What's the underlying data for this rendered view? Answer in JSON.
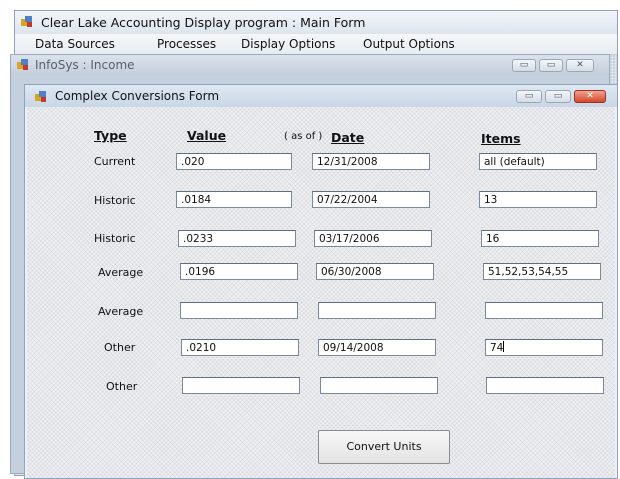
{
  "main_window": {
    "title": "Clear Lake Accounting Display program : Main Form",
    "menu": [
      "Data Sources",
      "Processes",
      "Display Options",
      "Output Options"
    ]
  },
  "child_window": {
    "title": "InfoSys : Income",
    "buttons": {
      "minimize": "▭",
      "maximize": "▭",
      "close": "✕"
    }
  },
  "form": {
    "title": "Complex Conversions Form",
    "buttons": {
      "minimize": "▭",
      "maximize": "▭",
      "close": "✕"
    },
    "headers": {
      "type": "Type",
      "value": "Value",
      "as_of": "( as of )",
      "date": "Date",
      "items": "Items"
    },
    "rows": [
      {
        "type": "Current",
        "value": ".020",
        "date": "12/31/2008",
        "items": "all (default)"
      },
      {
        "type": "Historic",
        "value": ".0184",
        "date": "07/22/2004",
        "items": "13"
      },
      {
        "type": "Historic",
        "value": ".0233",
        "date": "03/17/2006",
        "items": "16"
      },
      {
        "type": "Average",
        "value": ".0196",
        "date": "06/30/2008",
        "items": "51,52,53,54,55"
      },
      {
        "type": "Average",
        "value": "",
        "date": "",
        "items": ""
      },
      {
        "type": "Other",
        "value": ".0210",
        "date": "09/14/2008",
        "items": "74"
      },
      {
        "type": "Other",
        "value": "",
        "date": "",
        "items": ""
      }
    ],
    "convert_button": "Convert Units"
  },
  "colors": {
    "close_button": "#d6482b",
    "window_frame": "#c8d6e6",
    "field_border": "#7a8a9c"
  }
}
